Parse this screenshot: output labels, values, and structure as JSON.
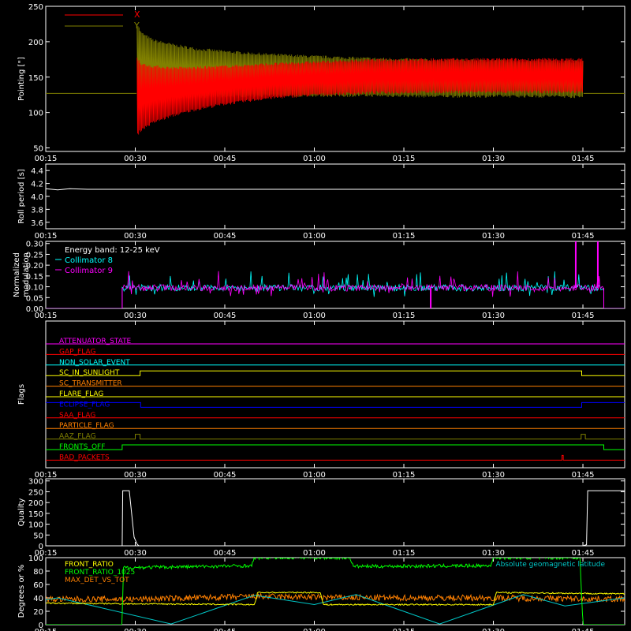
{
  "colors": {
    "axis": "#ffffff",
    "x_series": "#ff0000",
    "y_series": "#808000",
    "collimator8": "#00ffff",
    "collimator9": "#ff00ff",
    "white": "#ffffff",
    "front_ratio": "#ffff00",
    "front_ratio_hi": "#00ff00",
    "max_det": "#ff8000",
    "geomag": "#00c8c8"
  },
  "time_axis": {
    "range_minutes": [
      15,
      112
    ],
    "ticks": [
      "00:15",
      "00:30",
      "00:45",
      "01:00",
      "01:15",
      "01:30",
      "01:45"
    ],
    "tick_minutes": [
      15,
      30,
      45,
      60,
      75,
      90,
      105
    ]
  },
  "chart_data": [
    {
      "id": "pointing",
      "type": "line",
      "ylabel": "Pointing [\"]",
      "ylim": [
        45,
        250
      ],
      "yticks": [
        "50",
        "100",
        "150",
        "200",
        "250"
      ],
      "ytick_values": [
        50,
        100,
        150,
        200,
        250
      ],
      "legend": [
        "X",
        "Y"
      ],
      "legend_placement": "top-left",
      "baseline": 127,
      "series": [
        {
          "name": "X",
          "x": [
            15,
            30.2,
            30.3,
            31,
            33,
            36,
            40,
            45,
            52,
            60,
            70,
            80,
            90,
            100,
            105,
            105.1,
            112
          ],
          "low": [
            127,
            127,
            68,
            76,
            86,
            95,
            104,
            112,
            120,
            125,
            128,
            129,
            129,
            129,
            129,
            127,
            127
          ],
          "high": [
            127,
            127,
            178,
            168,
            165,
            163,
            163,
            165,
            168,
            171,
            174,
            175,
            175,
            175,
            175,
            127,
            127
          ]
        },
        {
          "name": "Y",
          "x": [
            15,
            30.2,
            30.3,
            31,
            33,
            36,
            40,
            45,
            52,
            60,
            70,
            80,
            90,
            100,
            105,
            105.1,
            112
          ],
          "low": [
            127,
            127,
            105,
            112,
            118,
            121,
            122,
            123,
            124,
            124,
            124,
            123,
            123,
            123,
            122,
            127,
            127
          ],
          "high": [
            127,
            127,
            226,
            212,
            202,
            196,
            190,
            186,
            182,
            179,
            176,
            174,
            173,
            172,
            172,
            127,
            127
          ]
        }
      ]
    },
    {
      "id": "roll",
      "type": "line",
      "ylabel": "Roll period [s]",
      "ylim": [
        3.5,
        4.5
      ],
      "yticks": [
        "3.6",
        "3.8",
        "4.0",
        "4.2",
        "4.4"
      ],
      "ytick_values": [
        3.6,
        3.8,
        4.0,
        4.2,
        4.4
      ],
      "series": [
        {
          "x": [
            15,
            17,
            19,
            22,
            112
          ],
          "values": [
            4.12,
            4.1,
            4.12,
            4.11,
            4.11
          ]
        }
      ]
    },
    {
      "id": "modulation",
      "type": "line",
      "ylabel": "Normalized modulation",
      "ylim": [
        0,
        0.31
      ],
      "yticks": [
        "0.00",
        "0.05",
        "0.10",
        "0.15",
        "0.20",
        "0.25",
        "0.30"
      ],
      "ytick_values": [
        0,
        0.05,
        0.1,
        0.15,
        0.2,
        0.25,
        0.3
      ],
      "legend_title": "Energy band: 12-25 keV",
      "legend": [
        "Collimator 8",
        "Collimator 9"
      ],
      "legend_placement": "top-left",
      "active_range": [
        27.8,
        108.5
      ],
      "mean_level": 0.095,
      "spikes": [
        {
          "x": 79.5,
          "y": 0.0,
          "series": "Collimator 9"
        },
        {
          "x": 103.8,
          "y": 0.31,
          "series": "Collimator 9"
        },
        {
          "x": 107.5,
          "y": 0.31,
          "series": "Collimator 9"
        }
      ],
      "series": [
        {
          "name": "Collimator 8"
        },
        {
          "name": "Collimator 9"
        }
      ]
    },
    {
      "id": "flags",
      "type": "line",
      "ylabel": "Flags",
      "rows": [
        {
          "name": "ATTENUATOR_STATE",
          "color": "#ff00ff",
          "transitions": []
        },
        {
          "name": "GAP_FLAG",
          "color": "#ff0000",
          "transitions": []
        },
        {
          "name": "NON_SOLAR_EVENT",
          "color": "#00ffff",
          "transitions": []
        },
        {
          "name": "SC_IN_SUNLIGHT",
          "color": "#ffff00",
          "transitions": [
            [
              15,
              0
            ],
            [
              30.8,
              1
            ],
            [
              104.8,
              0
            ]
          ]
        },
        {
          "name": "SC_TRANSMITTER",
          "color": "#ff8000",
          "transitions": []
        },
        {
          "name": "FLARE_FLAG",
          "color": "#ffff00",
          "transitions": []
        },
        {
          "name": "ECLIPSE_FLAG",
          "color": "#0000ff",
          "transitions": [
            [
              15,
              1
            ],
            [
              30.9,
              0
            ],
            [
              104.8,
              1
            ]
          ]
        },
        {
          "name": "SAA_FLAG",
          "color": "#ff0000",
          "transitions": []
        },
        {
          "name": "PARTICLE_FLAG",
          "color": "#ff8000",
          "transitions": []
        },
        {
          "name": "AAZ_FLAG",
          "color": "#808000",
          "transitions": [
            [
              15,
              0
            ],
            [
              30.0,
              1
            ],
            [
              30.8,
              0
            ],
            [
              104.7,
              1
            ],
            [
              105.4,
              0
            ]
          ]
        },
        {
          "name": "FRONTS_OFF",
          "color": "#00ff00",
          "transitions": [
            [
              15,
              0
            ],
            [
              27.8,
              1
            ],
            [
              108.5,
              0
            ]
          ]
        },
        {
          "name": "BAD_PACKETS",
          "color": "#ff0000",
          "transitions": [
            [
              15,
              0
            ],
            [
              101.5,
              1
            ],
            [
              101.7,
              0
            ]
          ]
        }
      ]
    },
    {
      "id": "quality",
      "type": "line",
      "ylabel": "Quality",
      "ylim": [
        0,
        310
      ],
      "yticks": [
        "0",
        "50",
        "100",
        "150",
        "200",
        "250",
        "300"
      ],
      "ytick_values": [
        0,
        50,
        100,
        150,
        200,
        250,
        300
      ],
      "series": [
        {
          "x": [
            15,
            27.8,
            27.9,
            29.0,
            29.8,
            30.3,
            30.6,
            105.0,
            105.6,
            105.8,
            112
          ],
          "values": [
            0,
            0,
            255,
            255,
            40,
            8,
            0,
            0,
            5,
            255,
            255
          ]
        }
      ]
    },
    {
      "id": "degrees",
      "type": "line",
      "ylabel": "Degrees or %",
      "ylim": [
        0,
        100
      ],
      "yticks": [
        "0",
        "20",
        "40",
        "60",
        "80",
        "100"
      ],
      "ytick_values": [
        0,
        20,
        40,
        60,
        80,
        100
      ],
      "legend": [
        "FRONT_RATIO",
        "FRONT_RATIO_1025",
        "MAX_DET_VS_TOT"
      ],
      "legend_placement": "top-left",
      "legend_right": "Absolute geomagnetic latitude",
      "series": [
        {
          "name": "FRONT_RATIO",
          "x": [
            15,
            50,
            50.5,
            61,
            61.5,
            90,
            90.5,
            112
          ],
          "values": [
            32,
            30,
            48,
            48,
            30,
            30,
            48,
            46
          ]
        },
        {
          "name": "FRONT_RATIO_1025",
          "x": [
            15,
            27.8,
            28,
            49.5,
            50,
            60.5,
            61,
            63,
            66,
            66.5,
            89.5,
            90,
            104.5,
            105,
            112
          ],
          "values": [
            0,
            0,
            85,
            88,
            100,
            100,
            100,
            100,
            100,
            87,
            88,
            100,
            100,
            0,
            0
          ]
        },
        {
          "name": "MAX_DET_VS_TOT",
          "x": [
            15,
            30,
            50,
            70,
            90,
            112
          ],
          "values": [
            38,
            38,
            42,
            40,
            40,
            38
          ]
        },
        {
          "name": "Absolute geomagnetic latitude",
          "x": [
            15,
            17,
            22,
            36,
            50,
            60,
            67,
            81,
            95,
            102,
            112
          ],
          "values": [
            37,
            40,
            30,
            1,
            44,
            30,
            45,
            1,
            45,
            28,
            40
          ]
        }
      ]
    }
  ]
}
